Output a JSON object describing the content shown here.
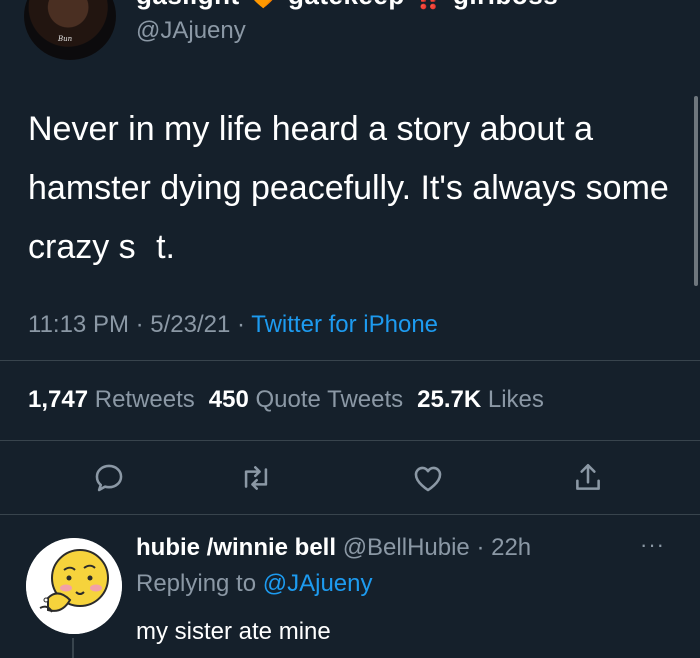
{
  "tweet": {
    "display_name": "gaslight 🧡 gatekeep ‼️ girlboss",
    "handle": "@JAjueny",
    "avatar_text": "Bun",
    "text": "Never in my life heard a story about a hamster dying peacefully. It's always some crazy s   t.",
    "time": "11:13 PM",
    "date": "5/23/21",
    "source": "Twitter for iPhone",
    "separator": " · ",
    "stats": {
      "retweets_count": "1,747",
      "retweets_label": "Retweets",
      "quotes_count": "450",
      "quotes_label": "Quote Tweets",
      "likes_count": "25.7K",
      "likes_label": "Likes"
    },
    "icons": [
      "reply-icon",
      "retweet-icon",
      "like-icon",
      "share-icon"
    ]
  },
  "reply": {
    "name": "hubie /winnie bell",
    "handle": "@BellHubie",
    "time": "22h",
    "separator": " · ",
    "replying_prefix": "Replying to",
    "replying_to": "@JAjueny",
    "text": "my sister ate mine",
    "more": "···"
  },
  "colors": {
    "background": "#15202b",
    "text": "#ffffff",
    "muted": "#8b98a5",
    "accent": "#1d9bf0",
    "divider": "#38444d"
  }
}
